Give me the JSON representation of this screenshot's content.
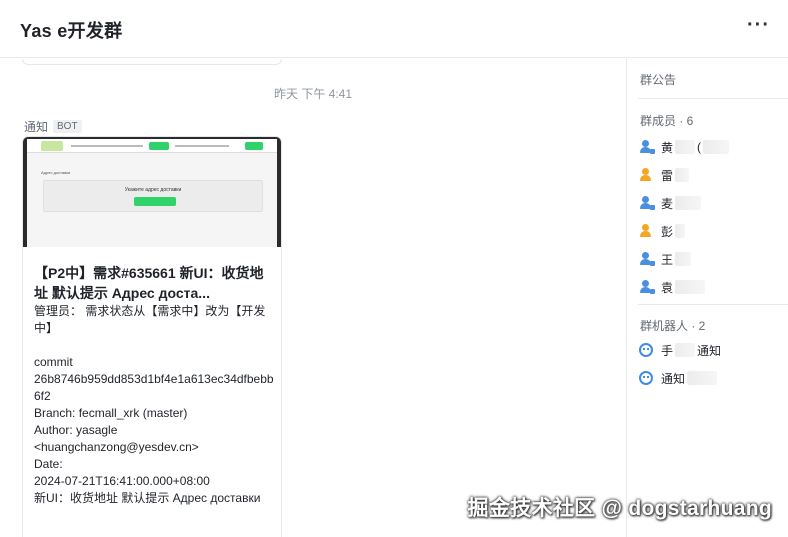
{
  "header": {
    "title": "Yas  e开发群",
    "more_icon": "more-horizontal-icon"
  },
  "chat": {
    "timestamp": "昨天 下午 4:41",
    "sender": "通知",
    "sender_badge": "BOT",
    "card": {
      "screenshot": {
        "subtitle": "Адрес доставки",
        "box_text": "Укажите адрес доставки"
      },
      "title": "【P2中】需求#635661 新UI：收货地址 默认提示 Адрес доста...",
      "body": "管理员： 需求状态从【需求中】改为【开发中】\n\ncommit\n26b8746b959dd853d1bf4e1a613ec34dfbebb6f2\nBranch: fecmall_xrk (master)\nAuthor: yasagle\n<huangchanzong@yesdev.cn>\nDate:\n2024-07-21T16:41:00.000+08:00\n新UI：收货地址 默认提示 Адрес доставки"
    }
  },
  "sidebar": {
    "announcement": "群公告",
    "members_header": "群成员 · 6",
    "members": [
      {
        "name": "黄",
        "suffix": "(",
        "icon": "user-admin-icon",
        "color": "#4a90e2"
      },
      {
        "name": "雷",
        "suffix": "",
        "icon": "user-icon",
        "color": "#f5a623"
      },
      {
        "name": "麦",
        "suffix": "",
        "icon": "user-admin-icon",
        "color": "#4a90e2"
      },
      {
        "name": "彭",
        "suffix": "",
        "icon": "user-icon",
        "color": "#f5a623"
      },
      {
        "name": "王",
        "suffix": "",
        "icon": "user-admin-icon",
        "color": "#4a90e2"
      },
      {
        "name": "袁",
        "suffix": "",
        "icon": "user-admin-icon",
        "color": "#4a90e2"
      }
    ],
    "robots_header": "群机器人 · 2",
    "robots": [
      {
        "name": "手",
        "suffix": "通知",
        "icon": "robot-icon"
      },
      {
        "name": "通知",
        "suffix": "",
        "icon": "robot-icon"
      }
    ]
  },
  "watermark": "掘金技术社区 @ dogstarhuang",
  "colors": {
    "accent_green": "#2fd36a",
    "admin_blue": "#4a90e2",
    "member_orange": "#f5a623",
    "robot_blue": "#3c8ce7"
  }
}
